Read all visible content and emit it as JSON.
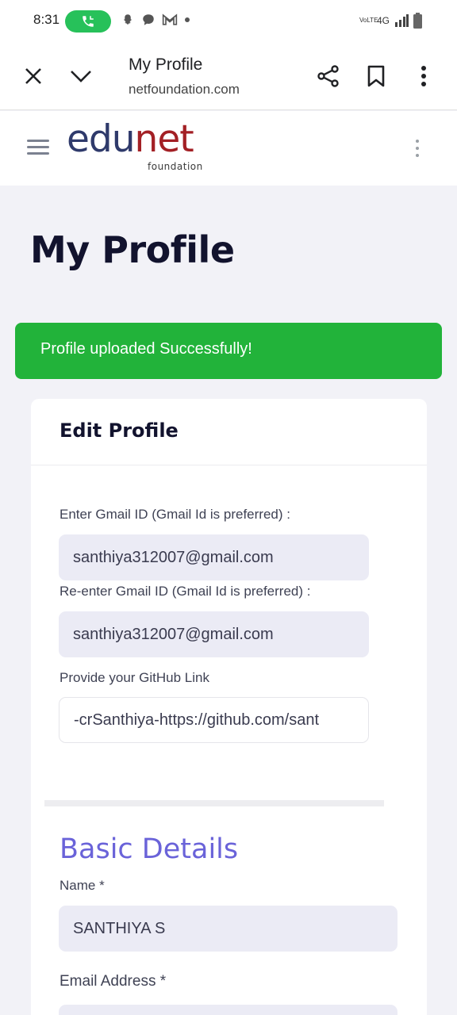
{
  "status_bar": {
    "time": "8:31",
    "network": "4G",
    "volte": "VoLTE"
  },
  "browser": {
    "title": "My Profile",
    "url": "netfoundation.com"
  },
  "site": {
    "logo_edu": "edu",
    "logo_net": "net",
    "logo_sub": "foundation"
  },
  "page": {
    "title": "My Profile",
    "alert": "Profile uploaded Successfully!"
  },
  "edit_profile": {
    "heading": "Edit Profile",
    "gmail_label": "Enter Gmail ID (Gmail Id is preferred) :",
    "gmail_value": "santhiya312007@gmail.com",
    "gmail_confirm_label": "Re-enter Gmail ID (Gmail Id is preferred) :",
    "gmail_confirm_value": "santhiya312007@gmail.com",
    "github_label": "Provide your GitHub Link",
    "github_value": "-crSanthiya-https://github.com/sant"
  },
  "basic_details": {
    "heading": "Basic Details",
    "name_label": "Name *",
    "name_value": "SANTHIYA S",
    "email_label": "Email Address *"
  },
  "colors": {
    "alert_bg": "#22b33a",
    "section_accent": "#6a63d9",
    "logo_edu": "#2f3a6b",
    "logo_net": "#a32025",
    "call_pill": "#27c15a"
  }
}
